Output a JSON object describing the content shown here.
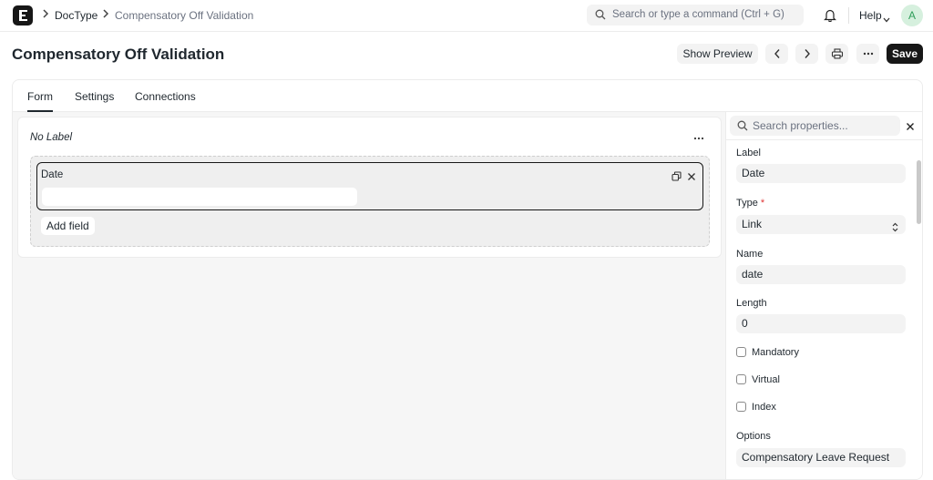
{
  "navbar": {
    "breadcrumbs": [
      "DocType",
      "Compensatory Off Validation"
    ],
    "search_placeholder": "Search or type a command (Ctrl + G)",
    "help_label": "Help",
    "avatar_initial": "A"
  },
  "header": {
    "title": "Compensatory Off Validation",
    "show_preview_label": "Show Preview",
    "save_label": "Save"
  },
  "tabs": [
    {
      "label": "Form",
      "active": true
    },
    {
      "label": "Settings",
      "active": false
    },
    {
      "label": "Connections",
      "active": false
    }
  ],
  "form": {
    "section_label": "No Label",
    "field": {
      "label": "Date"
    },
    "add_field_label": "Add field"
  },
  "properties": {
    "search_placeholder": "Search properties...",
    "label": {
      "title": "Label",
      "value": "Date"
    },
    "type": {
      "title": "Type",
      "required_mark": "*",
      "value": "Link"
    },
    "name": {
      "title": "Name",
      "value": "date"
    },
    "length": {
      "title": "Length",
      "value": "0"
    },
    "checkboxes": [
      {
        "label": "Mandatory",
        "checked": false
      },
      {
        "label": "Virtual",
        "checked": false
      },
      {
        "label": "Index",
        "checked": false
      }
    ],
    "options": {
      "title": "Options",
      "value": "Compensatory Leave Request"
    }
  },
  "colors": {
    "accent": "#171717",
    "avatar_bg": "#d6f0de",
    "avatar_fg": "#2f9e5a",
    "required": "#e03636"
  },
  "icons": [
    "app-logo-icon",
    "chevron-right-icon",
    "search-icon",
    "bell-icon",
    "chevron-down-icon",
    "chevron-left-icon",
    "printer-icon",
    "more-icon",
    "duplicate-icon",
    "close-icon",
    "select-arrows-icon"
  ]
}
